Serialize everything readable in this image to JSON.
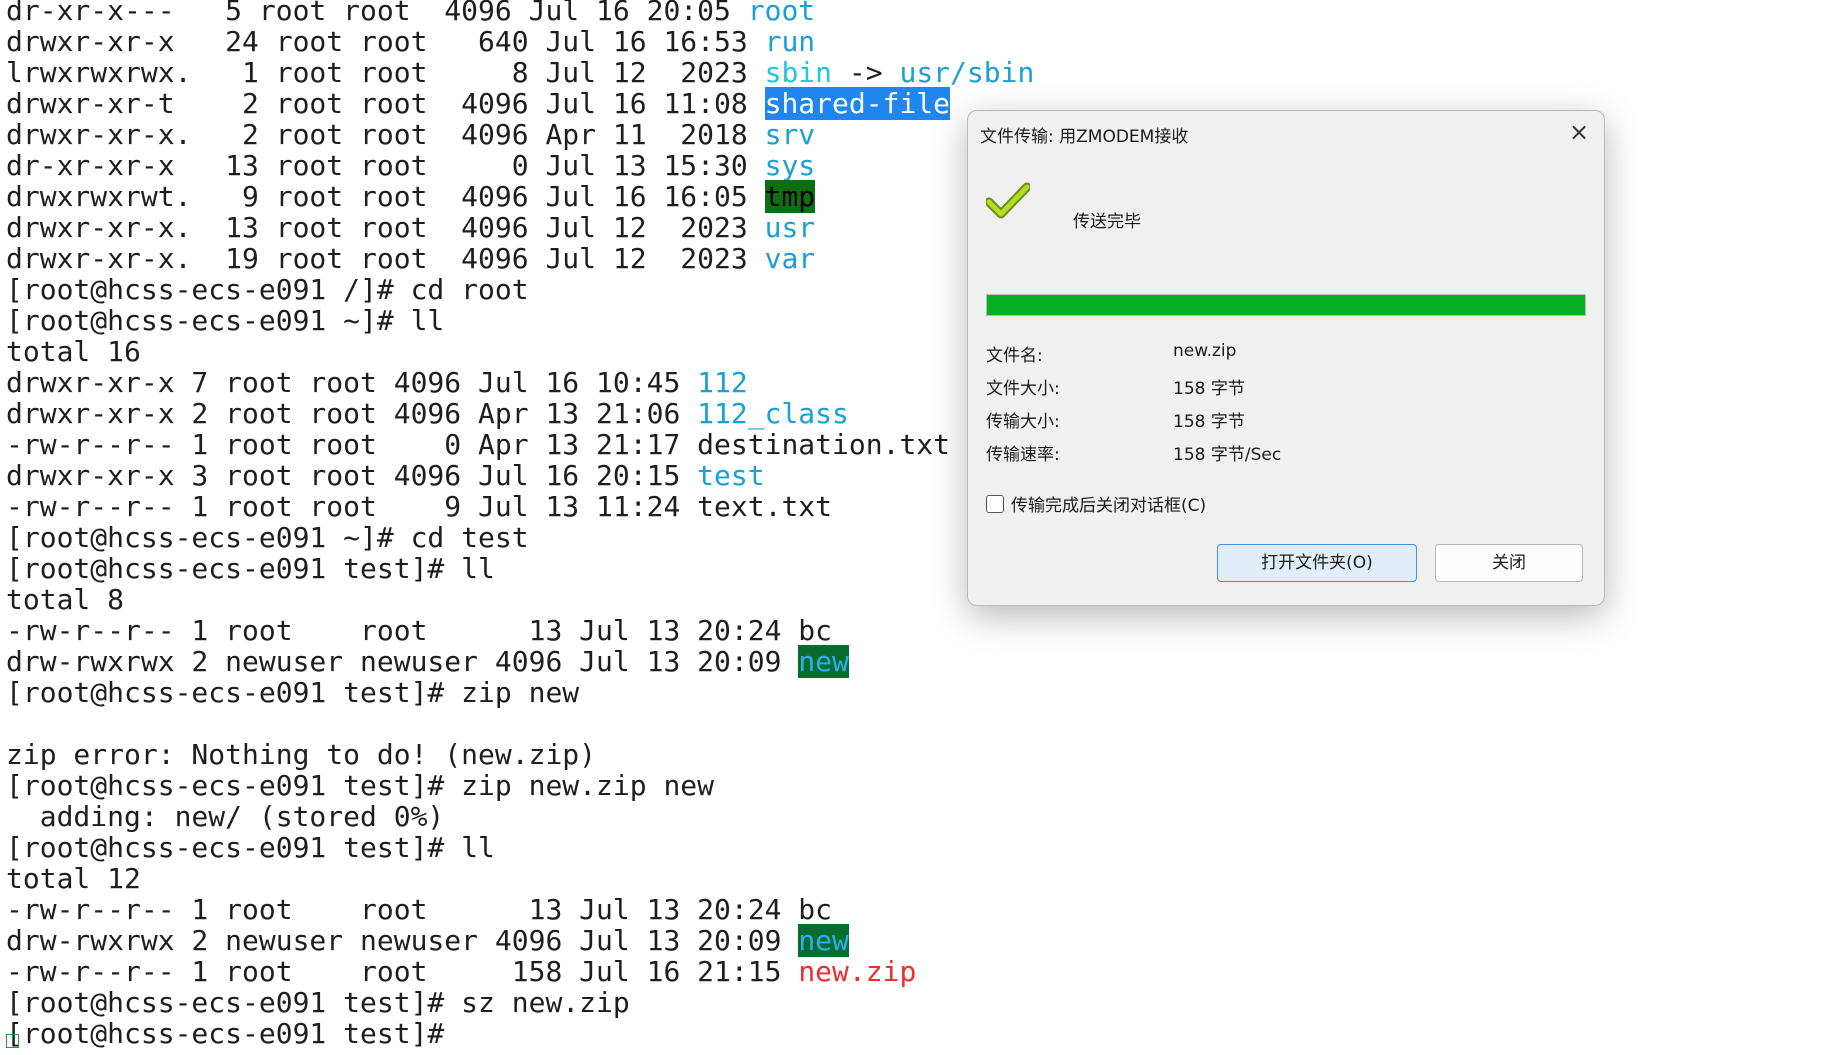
{
  "terminal": {
    "lines": [
      [
        {
          "t": "dr-xr-x---   5 root root  4096 Jul 16 20:05 "
        },
        {
          "t": "root",
          "c": "blue"
        }
      ],
      [
        {
          "t": "drwxr-xr-x   24 root root   640 Jul 16 16:53 "
        },
        {
          "t": "run",
          "c": "blue"
        }
      ],
      [
        {
          "t": "lrwxrwxrwx.   1 root root     8 Jul 12  2023 "
        },
        {
          "t": "sbin",
          "c": "cyan"
        },
        {
          "t": " -> "
        },
        {
          "t": "usr/sbin",
          "c": "blue"
        }
      ],
      [
        {
          "t": "drwxr-xr-t    2 root root  4096 Jul 16 11:08 "
        },
        {
          "t": "shared-file",
          "c": "hl-blue"
        }
      ],
      [
        {
          "t": "drwxr-xr-x.   2 root root  4096 Apr 11  2018 "
        },
        {
          "t": "srv",
          "c": "blue"
        }
      ],
      [
        {
          "t": "dr-xr-xr-x   13 root root     0 Jul 13 15:30 "
        },
        {
          "t": "sys",
          "c": "blue"
        }
      ],
      [
        {
          "t": "drwxrwxrwt.   9 root root  4096 Jul 16 16:05 "
        },
        {
          "t": "tmp",
          "c": "hl-green"
        }
      ],
      [
        {
          "t": "drwxr-xr-x.  13 root root  4096 Jul 12  2023 "
        },
        {
          "t": "usr",
          "c": "blue"
        }
      ],
      [
        {
          "t": "drwxr-xr-x.  19 root root  4096 Jul 12  2023 "
        },
        {
          "t": "var",
          "c": "blue"
        }
      ],
      [
        {
          "t": "[root@hcss-ecs-e091 /]# cd root"
        }
      ],
      [
        {
          "t": "[root@hcss-ecs-e091 ~]# ll"
        }
      ],
      [
        {
          "t": "total 16"
        }
      ],
      [
        {
          "t": "drwxr-xr-x 7 root root 4096 Jul 16 10:45 "
        },
        {
          "t": "112",
          "c": "blue"
        }
      ],
      [
        {
          "t": "drwxr-xr-x 2 root root 4096 Apr 13 21:06 "
        },
        {
          "t": "112_class",
          "c": "blue"
        }
      ],
      [
        {
          "t": "-rw-r--r-- 1 root root    0 Apr 13 21:17 destination.txt"
        }
      ],
      [
        {
          "t": "drwxr-xr-x 3 root root 4096 Jul 16 20:15 "
        },
        {
          "t": "test",
          "c": "blue"
        }
      ],
      [
        {
          "t": "-rw-r--r-- 1 root root    9 Jul 13 11:24 text.txt"
        }
      ],
      [
        {
          "t": "[root@hcss-ecs-e091 ~]# cd test"
        }
      ],
      [
        {
          "t": "[root@hcss-ecs-e091 test]# ll"
        }
      ],
      [
        {
          "t": "total 8"
        }
      ],
      [
        {
          "t": "-rw-r--r-- 1 root    root      13 Jul 13 20:24 bc"
        }
      ],
      [
        {
          "t": "drw-rwxrwx 2 newuser newuser 4096 Jul 13 20:09 "
        },
        {
          "t": "new",
          "c": "hl-teal"
        }
      ],
      [
        {
          "t": "[root@hcss-ecs-e091 test]# zip new"
        }
      ],
      [
        {
          "t": ""
        }
      ],
      [
        {
          "t": "zip error: Nothing to do! (new.zip)"
        }
      ],
      [
        {
          "t": "[root@hcss-ecs-e091 test]# zip new.zip new"
        }
      ],
      [
        {
          "t": "  adding: new/ (stored 0%)"
        }
      ],
      [
        {
          "t": "[root@hcss-ecs-e091 test]# ll"
        }
      ],
      [
        {
          "t": "total 12"
        }
      ],
      [
        {
          "t": "-rw-r--r-- 1 root    root      13 Jul 13 20:24 bc"
        }
      ],
      [
        {
          "t": "drw-rwxrwx 2 newuser newuser 4096 Jul 13 20:09 "
        },
        {
          "t": "new",
          "c": "hl-teal"
        }
      ],
      [
        {
          "t": "-rw-r--r-- 1 root    root     158 Jul 16 21:15 "
        },
        {
          "t": "new.zip",
          "c": "red"
        }
      ],
      [
        {
          "t": "[root@hcss-ecs-e091 test]# sz new.zip"
        }
      ],
      [
        {
          "t": "[root@hcss-ecs-e091 test]#"
        }
      ]
    ]
  },
  "dialog": {
    "title": "文件传输: 用ZMODEM接收",
    "close_icon": "×",
    "status": "传送完毕",
    "progress_fraction": 1.0,
    "progress_color": "#06b025",
    "info": [
      {
        "label": "文件名:",
        "value": "new.zip"
      },
      {
        "label": "文件大小:",
        "value": "158 字节"
      },
      {
        "label": "传输大小:",
        "value": "158 字节"
      },
      {
        "label": "传输速率:",
        "value": "158 字节/Sec"
      }
    ],
    "auto_close_label": "传输完成后关闭对话框(C)",
    "auto_close_checked": false,
    "open_folder_button": "打开文件夹(O)",
    "close_button": "关闭"
  }
}
